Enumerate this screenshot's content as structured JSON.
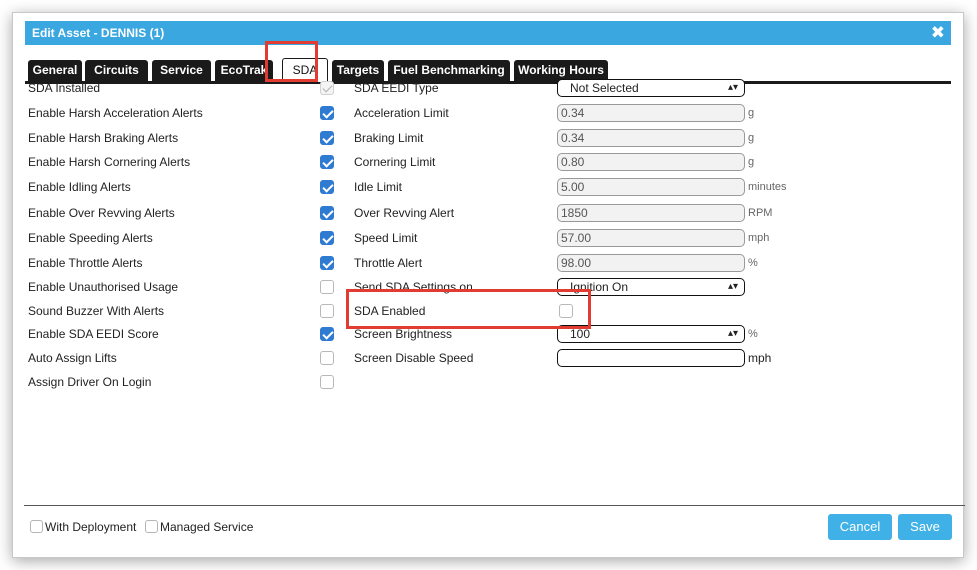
{
  "dialog": {
    "title": "Edit Asset - DENNIS (1)",
    "close_glyph": "✖"
  },
  "tabs": [
    {
      "label": "General",
      "active": false
    },
    {
      "label": "Circuits",
      "active": false
    },
    {
      "label": "Service",
      "active": false
    },
    {
      "label": "EcoTrak",
      "active": false
    },
    {
      "label": "SDA",
      "active": true
    },
    {
      "label": "Targets",
      "active": false
    },
    {
      "label": "Fuel Benchmarking",
      "active": false
    },
    {
      "label": "Working Hours",
      "active": false
    }
  ],
  "left_settings": [
    {
      "label": "SDA Installed",
      "checked": true,
      "disabled": true
    },
    {
      "label": "Enable Harsh Acceleration Alerts",
      "checked": true,
      "disabled": false
    },
    {
      "label": "Enable Harsh Braking Alerts",
      "checked": true,
      "disabled": false
    },
    {
      "label": "Enable Harsh Cornering Alerts",
      "checked": true,
      "disabled": false
    },
    {
      "label": "Enable Idling Alerts",
      "checked": true,
      "disabled": false
    },
    {
      "label": "Enable Over Revving Alerts",
      "checked": true,
      "disabled": false
    },
    {
      "label": "Enable Speeding Alerts",
      "checked": true,
      "disabled": false
    },
    {
      "label": "Enable Throttle Alerts",
      "checked": true,
      "disabled": false
    },
    {
      "label": "Enable Unauthorised Usage",
      "checked": false,
      "disabled": false
    },
    {
      "label": "Sound Buzzer With Alerts",
      "checked": false,
      "disabled": false
    },
    {
      "label": "Enable SDA EEDI Score",
      "checked": true,
      "disabled": false
    },
    {
      "label": "Auto Assign Lifts",
      "checked": false,
      "disabled": false
    },
    {
      "label": "Assign Driver On Login",
      "checked": false,
      "disabled": false
    }
  ],
  "right_settings": {
    "eedi_type": {
      "label": "SDA EEDI Type",
      "value": "Not Selected"
    },
    "acceleration": {
      "label": "Acceleration Limit",
      "value": "0.34",
      "unit": "g"
    },
    "braking": {
      "label": "Braking Limit",
      "value": "0.34",
      "unit": "g"
    },
    "cornering": {
      "label": "Cornering Limit",
      "value": "0.80",
      "unit": "g"
    },
    "idle": {
      "label": "Idle Limit",
      "value": "5.00",
      "unit": "minutes"
    },
    "over_revving": {
      "label": "Over Revving Alert",
      "value": "1850",
      "unit": "RPM"
    },
    "speed": {
      "label": "Speed Limit",
      "value": "57.00",
      "unit": "mph"
    },
    "throttle": {
      "label": "Throttle Alert",
      "value": "98.00",
      "unit": "%"
    },
    "send_settings": {
      "label": "Send SDA Settings on",
      "value": "Ignition On"
    },
    "sda_enabled": {
      "label": "SDA Enabled",
      "checked": false
    },
    "brightness": {
      "label": "Screen Brightness",
      "value": "100",
      "unit": "%"
    },
    "disable_speed": {
      "label": "Screen Disable Speed",
      "value": "",
      "unit": "mph"
    }
  },
  "footer": {
    "with_deployment": "With Deployment",
    "managed_service": "Managed Service",
    "cancel": "Cancel",
    "save": "Save"
  },
  "colors": {
    "title_bar": "#3aa7e0",
    "checkbox_checked": "#2f7bd1",
    "tab_dark": "#1a1a1a",
    "highlight": "#e23b32",
    "button": "#40b1e6"
  },
  "icons": {
    "close": "close-icon",
    "select_arrow": "chevron-updown-icon",
    "check": "check-icon"
  }
}
